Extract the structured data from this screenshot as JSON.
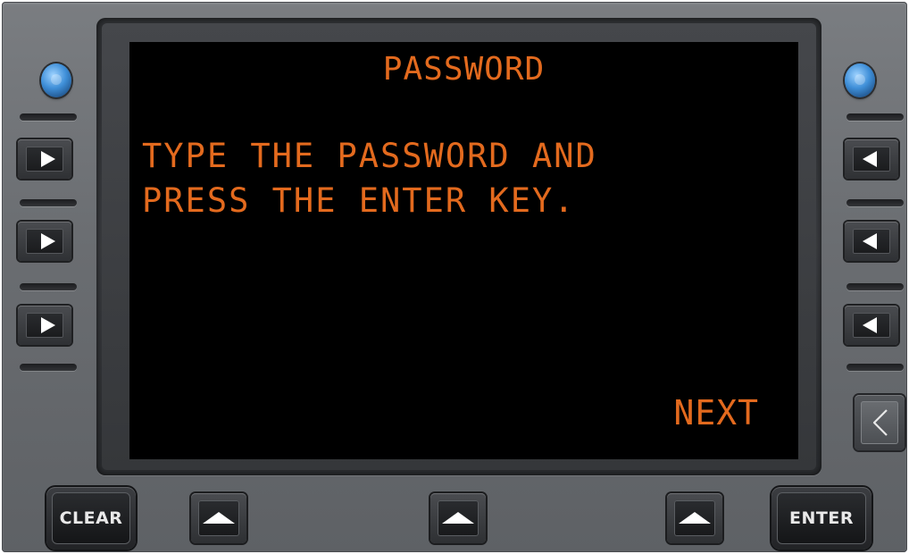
{
  "screen": {
    "title": "PASSWORD",
    "line1": "TYPE THE PASSWORD AND",
    "line2": "PRESS THE ENTER KEY.",
    "next_label": "NEXT"
  },
  "keys": {
    "clear_label": "CLEAR",
    "enter_label": "ENTER"
  },
  "icons": {
    "line_select_left": "triangle-right-icon",
    "line_select_right": "triangle-left-icon",
    "back": "chevron-left-icon",
    "up": "triangle-up-icon",
    "knob": "knob-icon"
  },
  "colors": {
    "display_text": "#e36a1e",
    "display_background": "#000000",
    "bezel": "#6a6d71"
  }
}
